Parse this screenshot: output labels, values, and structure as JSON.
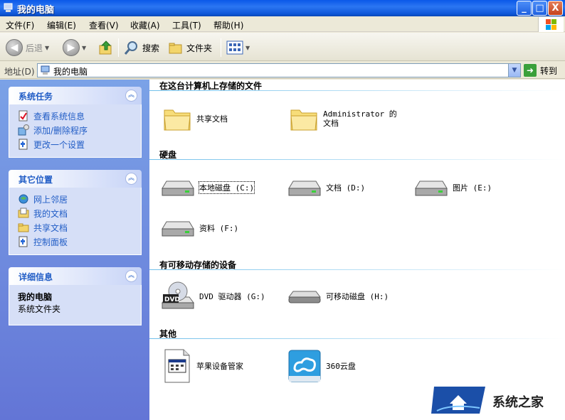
{
  "window": {
    "title": "我的电脑",
    "controls": {
      "minimize": "_",
      "maximize": "□",
      "close": "X"
    }
  },
  "menu": [
    "文件(F)",
    "编辑(E)",
    "查看(V)",
    "收藏(A)",
    "工具(T)",
    "帮助(H)"
  ],
  "toolbar": {
    "back": "后退",
    "search": "搜索",
    "folders": "文件夹"
  },
  "address": {
    "label": "地址(D)",
    "value": "我的电脑",
    "go": "转到"
  },
  "sidebar": {
    "system_tasks": {
      "title": "系统任务",
      "items": [
        "查看系统信息",
        "添加/删除程序",
        "更改一个设置"
      ]
    },
    "other_places": {
      "title": "其它位置",
      "items": [
        "网上邻居",
        "我的文档",
        "共享文档",
        "控制面板"
      ]
    },
    "details": {
      "title": "详细信息",
      "name": "我的电脑",
      "desc": "系统文件夹"
    }
  },
  "groups": {
    "stored_files": {
      "title": "在这台计算机上存储的文件",
      "items": [
        "共享文档",
        "Administrator 的文档"
      ]
    },
    "hard_disks": {
      "title": "硬盘",
      "items": [
        "本地磁盘 (C:)",
        "文档 (D:)",
        "图片 (E:)",
        "资料 (F:)"
      ]
    },
    "removable": {
      "title": "有可移动存储的设备",
      "items": [
        "DVD 驱动器 (G:)",
        "可移动磁盘 (H:)"
      ]
    },
    "other": {
      "title": "其他",
      "items": [
        "苹果设备管家",
        "360云盘"
      ]
    }
  },
  "watermark": {
    "text": "系统之家"
  }
}
